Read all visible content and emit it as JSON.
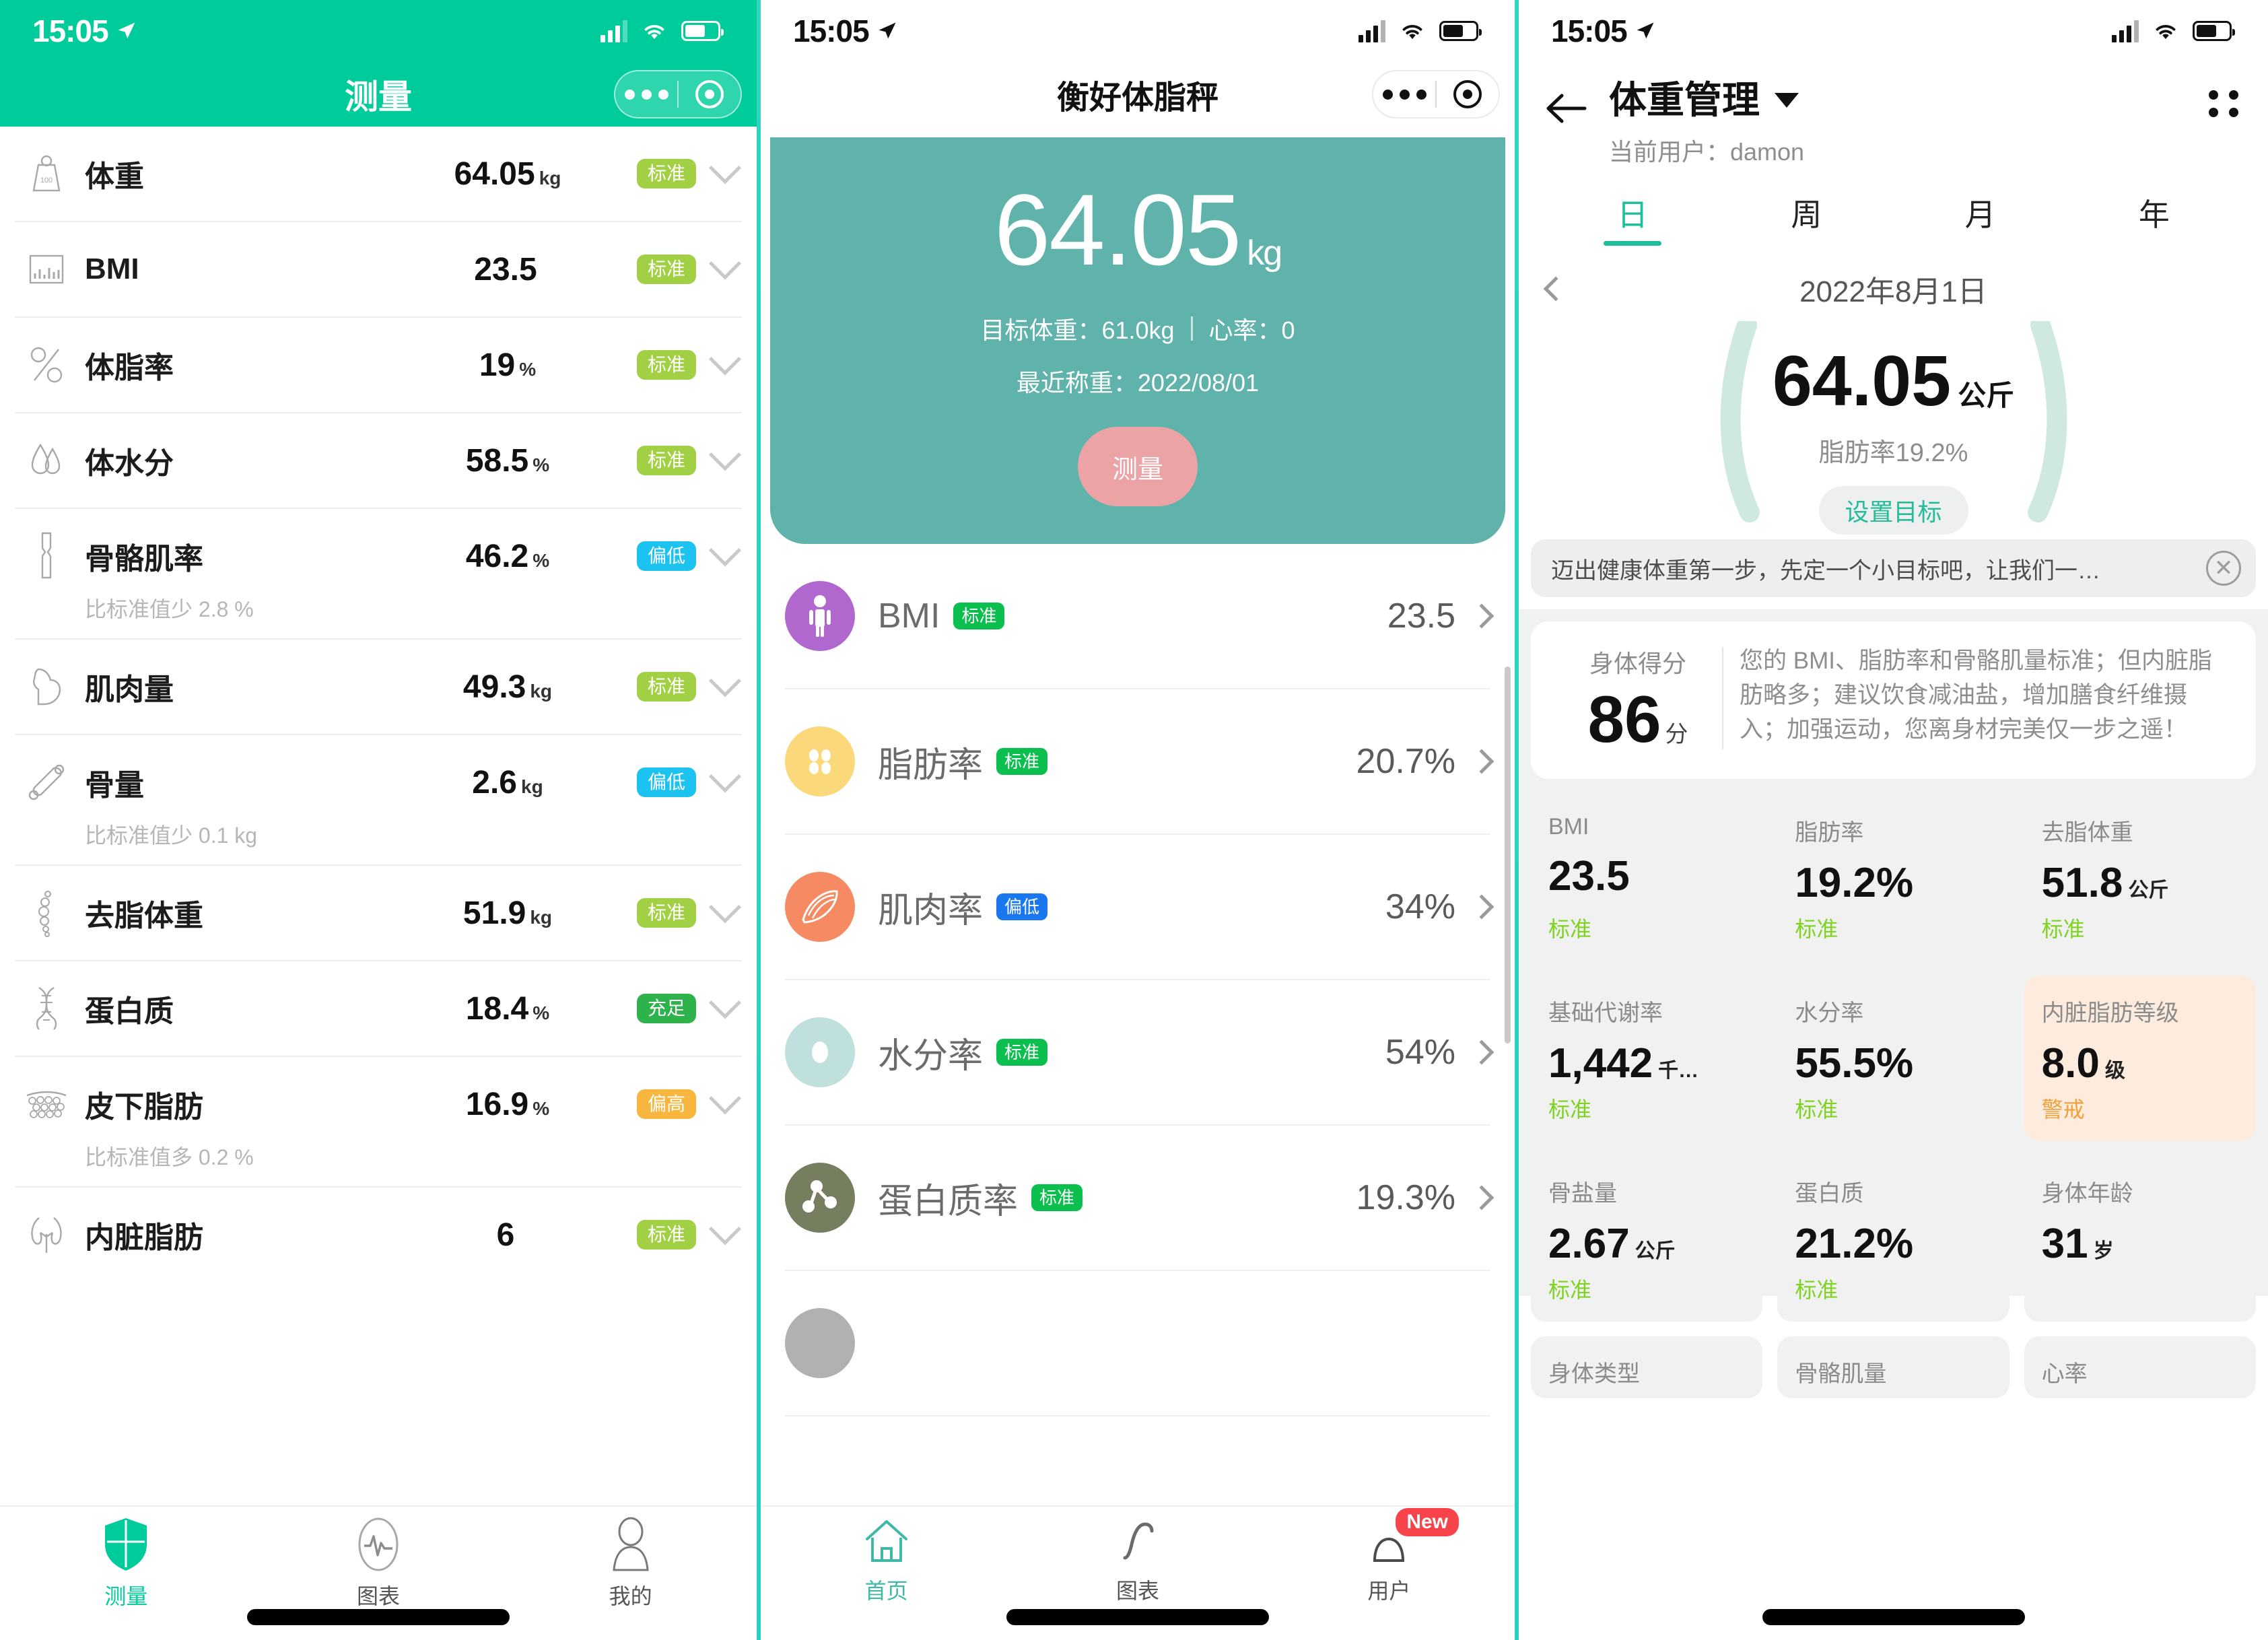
{
  "colors": {
    "background": "#23c9b4",
    "panel1_header": "#00cc9b",
    "panel2_hero": "#5fb3ab",
    "accent_teal": "#1fbf9e",
    "tag_standard": "#a2d045",
    "tag_low": "#1cc3f0",
    "tag_high": "#f8b63e",
    "tag_full": "#2eb24c",
    "badge_new": "#f9434a",
    "measure_button": "#eca3a6",
    "warn_card": "#fdebdd",
    "status_green_text": "#7ed321",
    "status_warn_text": "#f1a13c"
  },
  "status_bar": {
    "time": "15:05",
    "location_icon": "location-arrow-icon",
    "signal_icon": "cellular-signal-icon",
    "wifi_icon": "wifi-icon",
    "battery_icon": "battery-icon"
  },
  "panel1": {
    "title": "测量",
    "capsule": {
      "more_icon": "more-dots-icon",
      "target_icon": "target-circle-icon"
    },
    "rows": [
      {
        "icon": "weight-icon",
        "label": "体重",
        "value": "64.05",
        "unit": "kg",
        "tag": "标准",
        "tag_type": "std",
        "sub": ""
      },
      {
        "icon": "bmi-chart-icon",
        "label": "BMI",
        "value": "23.5",
        "unit": "",
        "tag": "标准",
        "tag_type": "std",
        "sub": ""
      },
      {
        "icon": "percent-icon",
        "label": "体脂率",
        "value": "19",
        "unit": "%",
        "tag": "标准",
        "tag_type": "std",
        "sub": ""
      },
      {
        "icon": "water-drop-icon",
        "label": "体水分",
        "value": "58.5",
        "unit": "%",
        "tag": "标准",
        "tag_type": "std",
        "sub": ""
      },
      {
        "icon": "bone-joint-icon",
        "label": "骨骼肌率",
        "value": "46.2",
        "unit": "%",
        "tag": "偏低",
        "tag_type": "low",
        "sub": "比标准值少 2.8 %"
      },
      {
        "icon": "muscle-arm-icon",
        "label": "肌肉量",
        "value": "49.3",
        "unit": "kg",
        "tag": "标准",
        "tag_type": "std",
        "sub": ""
      },
      {
        "icon": "bone-icon",
        "label": "骨量",
        "value": "2.6",
        "unit": "kg",
        "tag": "偏低",
        "tag_type": "low",
        "sub": "比标准值少 0.1 kg"
      },
      {
        "icon": "spine-icon",
        "label": "去脂体重",
        "value": "51.9",
        "unit": "kg",
        "tag": "标准",
        "tag_type": "std",
        "sub": ""
      },
      {
        "icon": "dna-icon",
        "label": "蛋白质",
        "value": "18.4",
        "unit": "%",
        "tag": "充足",
        "tag_type": "full",
        "sub": ""
      },
      {
        "icon": "fat-tissue-icon",
        "label": "皮下脂肪",
        "value": "16.9",
        "unit": "%",
        "tag": "偏高",
        "tag_type": "high",
        "sub": "比标准值多 0.2 %"
      },
      {
        "icon": "organs-icon",
        "label": "内脏脂肪",
        "value": "6",
        "unit": "",
        "tag": "标准",
        "tag_type": "std",
        "sub": ""
      }
    ],
    "tabs": [
      {
        "icon": "shield-icon",
        "label": "测量",
        "active": true
      },
      {
        "icon": "pulse-icon",
        "label": "图表",
        "active": false
      },
      {
        "icon": "person-icon",
        "label": "我的",
        "active": false
      }
    ]
  },
  "panel2": {
    "title": "衡好体脂秤",
    "capsule": {
      "more_icon": "more-dots-icon",
      "target_icon": "target-circle-icon"
    },
    "hero": {
      "weight": "64.05",
      "weight_unit": "kg",
      "goal_label": "目标体重：61.0kg",
      "heart_label": "心率：0",
      "last_weigh": "最近称重：2022/08/01",
      "measure_button": "测量"
    },
    "rows": [
      {
        "icon": "body-person-icon",
        "icon_color": "#b168ce",
        "name": "BMI",
        "badge": "标准",
        "badge_type": "std",
        "value": "23.5"
      },
      {
        "icon": "fat-cells-icon",
        "icon_color": "#fbd97b",
        "name": "脂肪率",
        "badge": "标准",
        "badge_type": "std",
        "value": "20.7%"
      },
      {
        "icon": "muscle-fiber-icon",
        "icon_color": "#f58a63",
        "name": "肌肉率",
        "badge": "偏低",
        "badge_type": "low",
        "value": "34%"
      },
      {
        "icon": "water-ring-icon",
        "icon_color": "#bfe0dc",
        "name": "水分率",
        "badge": "标准",
        "badge_type": "std",
        "value": "54%"
      },
      {
        "icon": "molecule-icon",
        "icon_color": "#757f60",
        "name": "蛋白质率",
        "badge": "标准",
        "badge_type": "std",
        "value": "19.3%"
      }
    ],
    "tabs": [
      {
        "icon": "home-icon",
        "label": "首页",
        "active": true,
        "badge": ""
      },
      {
        "icon": "curve-icon",
        "label": "图表",
        "active": false,
        "badge": ""
      },
      {
        "icon": "user-icon",
        "label": "用户",
        "active": false,
        "badge": "New"
      }
    ]
  },
  "panel3": {
    "back_icon": "back-arrow-icon",
    "title": "体重管理",
    "title_dropdown_icon": "chevron-down-icon",
    "subtitle": "当前用户：damon",
    "menu_icon": "grid-menu-icon",
    "tabs": [
      {
        "label": "日",
        "active": true
      },
      {
        "label": "周",
        "active": false
      },
      {
        "label": "月",
        "active": false
      },
      {
        "label": "年",
        "active": false
      }
    ],
    "date_prev_icon": "chevron-left-icon",
    "date": "2022年8月1日",
    "gauge": {
      "value": "64.05",
      "unit": "公斤",
      "sub": "脂肪率19.2%",
      "goal_button": "设置目标"
    },
    "tip": {
      "text": "迈出健康体重第一步，先定一个小目标吧，让我们一…",
      "close_icon": "close-circle-icon"
    },
    "score": {
      "title": "身体得分",
      "value": "86",
      "unit": "分",
      "description": "您的 BMI、脂肪率和骨骼肌量标准；但内脏脂肪略多；建议饮食减油盐，增加膳食纤维摄入；加强运动，您离身材完美仅一步之遥！"
    },
    "metrics": [
      {
        "title": "BMI",
        "value": "23.5",
        "unit": "",
        "status": "标准",
        "warn": false
      },
      {
        "title": "脂肪率",
        "value": "19.2%",
        "unit": "",
        "status": "标准",
        "warn": false
      },
      {
        "title": "去脂体重",
        "value": "51.8",
        "unit": "公斤",
        "status": "标准",
        "warn": false
      },
      {
        "title": "基础代谢率",
        "value": "1,442",
        "unit": "千…",
        "status": "标准",
        "warn": false
      },
      {
        "title": "水分率",
        "value": "55.5%",
        "unit": "",
        "status": "标准",
        "warn": false
      },
      {
        "title": "内脏脂肪等级",
        "value": "8.0",
        "unit": "级",
        "status": "警戒",
        "warn": true
      },
      {
        "title": "骨盐量",
        "value": "2.67",
        "unit": "公斤",
        "status": "标准",
        "warn": false
      },
      {
        "title": "蛋白质",
        "value": "21.2%",
        "unit": "",
        "status": "标准",
        "warn": false
      },
      {
        "title": "身体年龄",
        "value": "31",
        "unit": "岁",
        "status": "",
        "warn": false
      }
    ],
    "metrics_cut": [
      {
        "title": "身体类型"
      },
      {
        "title": "骨骼肌量"
      },
      {
        "title": "心率"
      }
    ]
  }
}
